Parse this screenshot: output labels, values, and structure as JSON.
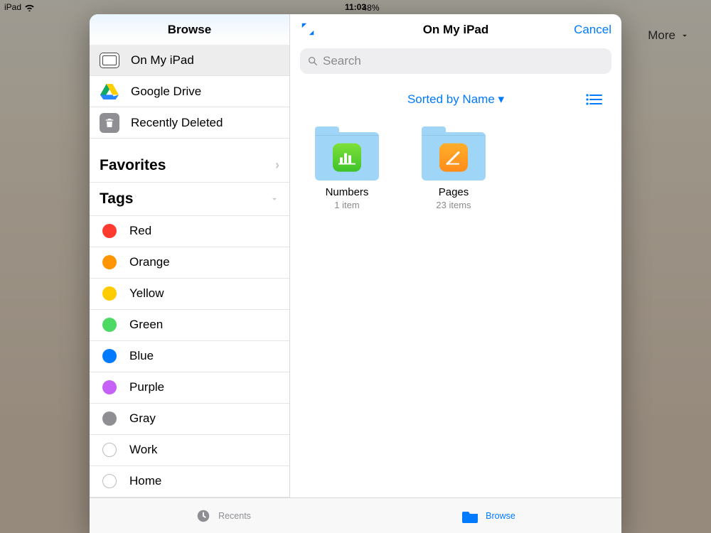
{
  "status": {
    "carrier": "iPad",
    "time": "11:03",
    "battery_pct": "48%",
    "battery_fill": 48
  },
  "bg": {
    "more": "More"
  },
  "sidebar": {
    "title": "Browse",
    "locations": [
      {
        "label": "On My iPad",
        "icon": "ipad-icon",
        "selected": true
      },
      {
        "label": "Google Drive",
        "icon": "gdrive-icon",
        "selected": false
      },
      {
        "label": "Recently Deleted",
        "icon": "trash-icon",
        "selected": false
      }
    ],
    "favorites_header": "Favorites",
    "tags_header": "Tags",
    "tags": [
      {
        "label": "Red",
        "color": "#ff3b30"
      },
      {
        "label": "Orange",
        "color": "#ff9500"
      },
      {
        "label": "Yellow",
        "color": "#ffcc00"
      },
      {
        "label": "Green",
        "color": "#4cd964"
      },
      {
        "label": "Blue",
        "color": "#007aff"
      },
      {
        "label": "Purple",
        "color": "#c561f6"
      },
      {
        "label": "Gray",
        "color": "#8e8e93"
      },
      {
        "label": "Work",
        "color": null
      },
      {
        "label": "Home",
        "color": null
      }
    ]
  },
  "main": {
    "title": "On My iPad",
    "cancel": "Cancel",
    "search_placeholder": "Search",
    "sort_label": "Sorted by Name",
    "items": [
      {
        "name": "Numbers",
        "meta": "1 item",
        "app": "numbers"
      },
      {
        "name": "Pages",
        "meta": "23 items",
        "app": "pages"
      }
    ]
  },
  "tabs": {
    "recents": "Recents",
    "browse": "Browse"
  },
  "colors": {
    "tint": "#007aff"
  }
}
